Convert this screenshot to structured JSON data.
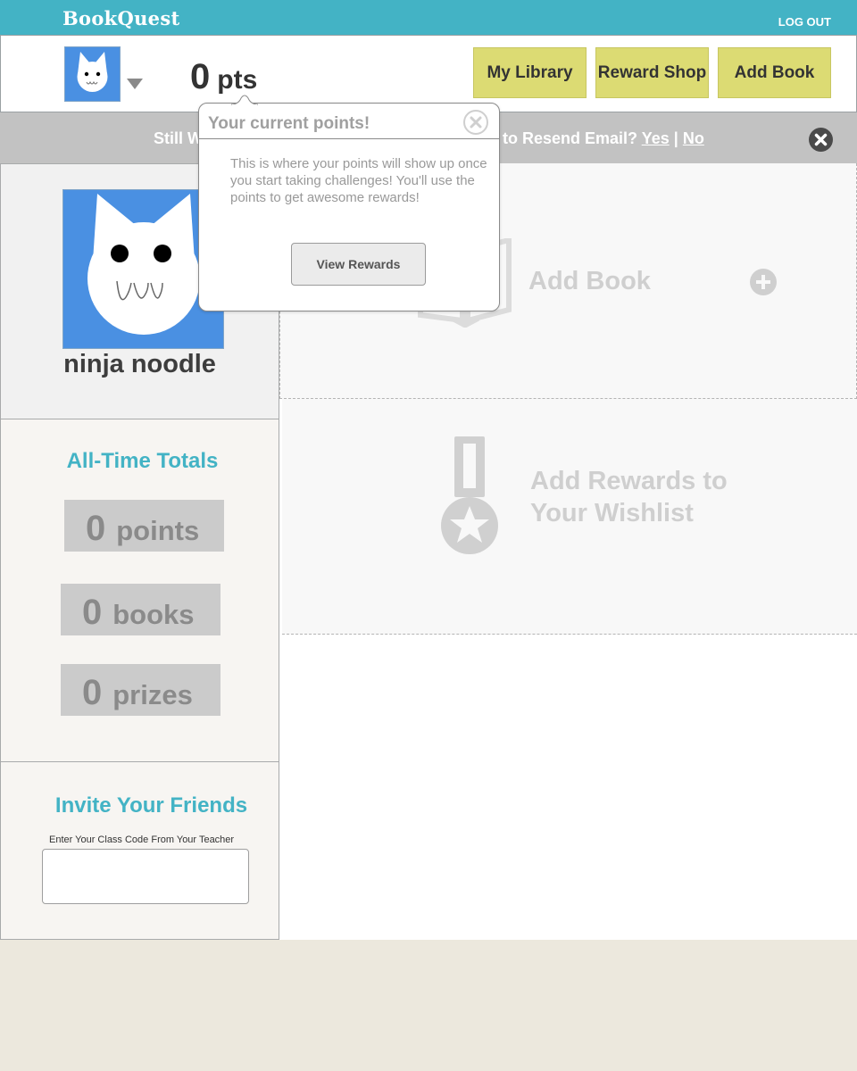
{
  "app": {
    "logo": "BookQuest",
    "logout": "LOG OUT"
  },
  "header": {
    "points_value": "0",
    "points_unit": "pts",
    "nav": [
      "My Library",
      "Reward Shop",
      "Add Book"
    ]
  },
  "banner": {
    "text_left": "Still W",
    "text_right": "to Resend Email?",
    "yes": "Yes",
    "separator": "|",
    "no": "No"
  },
  "profile": {
    "username": "ninja noodle"
  },
  "totals": {
    "title": "All-Time Totals",
    "points": {
      "value": "0",
      "unit": "points"
    },
    "books": {
      "value": "0",
      "unit": "books"
    },
    "prizes": {
      "value": "0",
      "unit": "prizes"
    }
  },
  "invite": {
    "title": "Invite Your Friends",
    "label": "Enter Your Class Code From Your Teacher",
    "value": ""
  },
  "main": {
    "add_book": "Add Book",
    "add_rewards_line1": "Add Rewards to",
    "add_rewards_line2": "Your Wishlist"
  },
  "popover": {
    "title": "Your current points!",
    "body": "This is where your points will show up once you start taking challenges! You'll use the points to get awesome rewards!",
    "button": "View Rewards"
  },
  "colors": {
    "topbar": "#43b3c5",
    "nav_button": "#dcdb73",
    "avatar_bg": "#4a90e2",
    "accent_text": "#43b3c5",
    "banner": "#c2c2c2",
    "page_bg": "#ece8dd"
  },
  "icons": [
    "cat-avatar-icon",
    "caret-down-icon",
    "close-icon",
    "book-icon",
    "medal-icon",
    "plus-circle-icon"
  ]
}
